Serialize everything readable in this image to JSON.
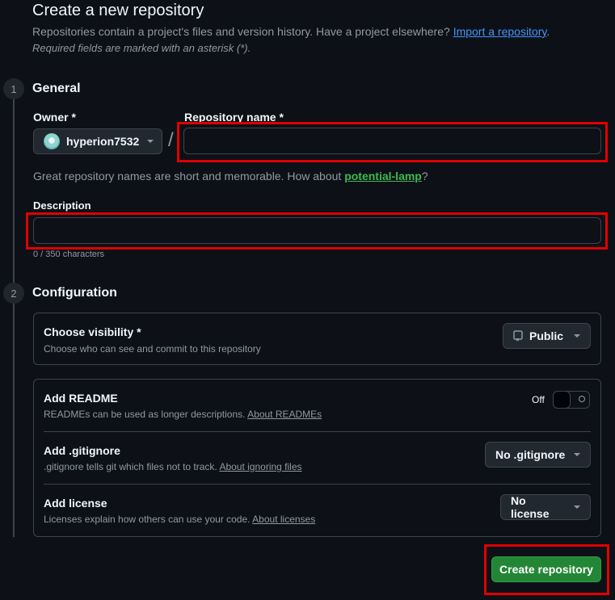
{
  "header": {
    "title": "Create a new repository",
    "subtitle_text": "Repositories contain a project's files and version history. Have a project elsewhere?",
    "import_link": "Import a repository",
    "subtitle_end": ".",
    "required_note": "Required fields are marked with an asterisk (*)."
  },
  "general": {
    "step": "1",
    "heading": "General",
    "owner_label": "Owner *",
    "owner_value": "hyperion7532",
    "slash": "/",
    "repo_name_label": "Repository name *",
    "repo_name_value": "",
    "helper_prefix": "Great repository names are short and memorable. How about",
    "suggestion": "potential-lamp",
    "helper_suffix": "?",
    "description_label": "Description",
    "description_value": "",
    "char_count": "0 / 350 characters"
  },
  "configuration": {
    "step": "2",
    "heading": "Configuration",
    "visibility": {
      "title": "Choose visibility *",
      "desc": "Choose who can see and commit to this repository",
      "value": "Public",
      "icon": "repo-icon"
    },
    "readme": {
      "title": "Add README",
      "desc": "READMEs can be used as longer descriptions.",
      "link": "About READMEs",
      "toggle_state": "Off"
    },
    "gitignore": {
      "title": "Add .gitignore",
      "desc": ".gitignore tells git which files not to track.",
      "link": "About ignoring files",
      "value": "No .gitignore"
    },
    "license": {
      "title": "Add license",
      "desc": "Licenses explain how others can use your code.",
      "link": "About licenses",
      "value": "No license"
    }
  },
  "actions": {
    "create_label": "Create repository"
  },
  "colors": {
    "background": "#0d1117",
    "link": "#4493f8",
    "suggestion": "#3fb950",
    "primary_button": "#238636",
    "highlight_box": "#e00000"
  }
}
